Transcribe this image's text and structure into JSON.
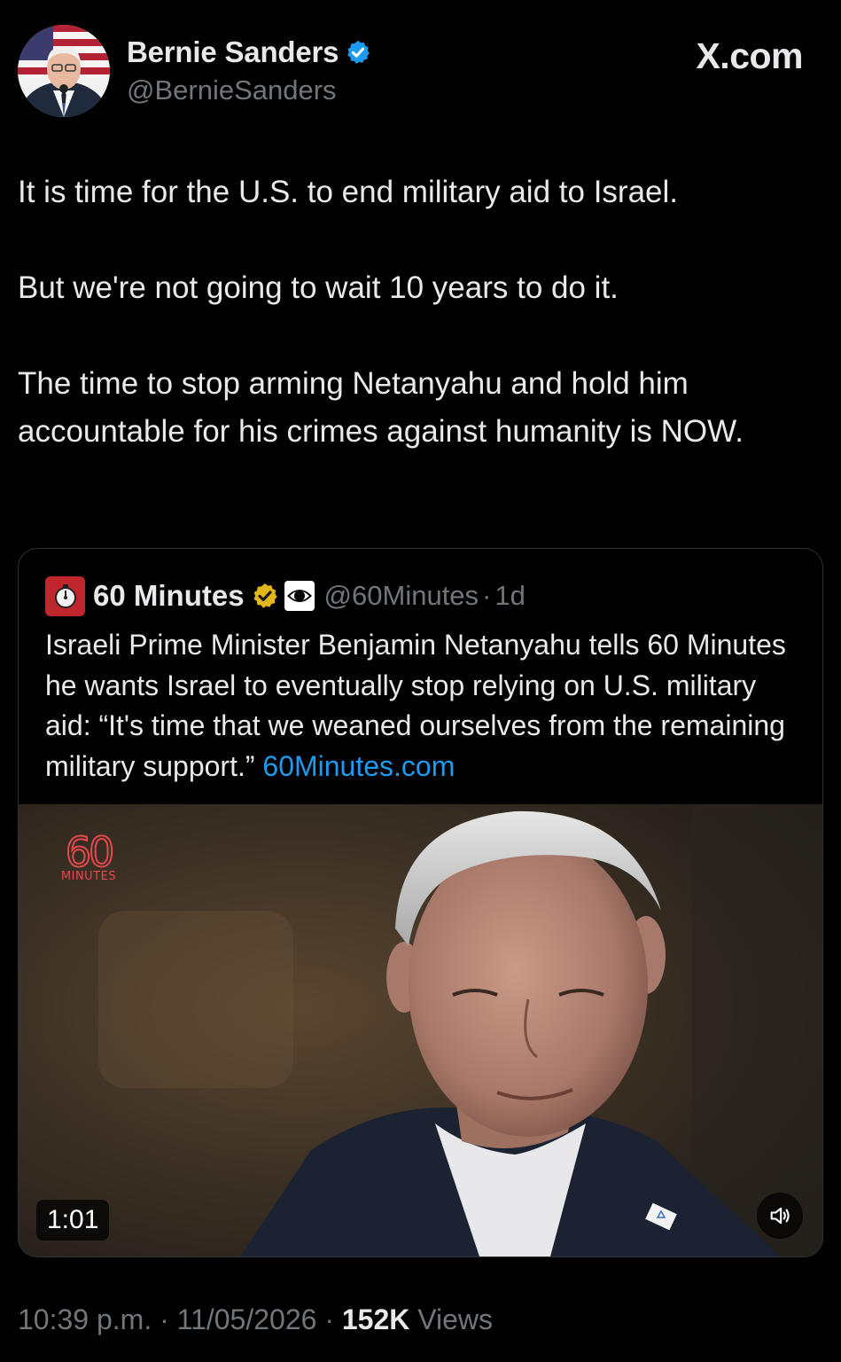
{
  "author": {
    "display_name": "Bernie Sanders",
    "handle": "@BernieSanders",
    "verified": true,
    "verified_badge_color": "#1d9bf0"
  },
  "site_label": "X.com",
  "tweet": {
    "paragraphs": [
      "It is time for the U.S. to end military aid to Israel.",
      "But we're not going to wait 10 years to do it.",
      "The time to stop arming Netanyahu and hold him accountable for his crimes against humanity is NOW."
    ]
  },
  "quote": {
    "display_name": "60 Minutes",
    "verified_badge_color": "#e2b719",
    "affiliate_icon": "cbs-eye-icon",
    "handle": "@60Minutes",
    "separator": "·",
    "time": "1d",
    "text": "Israeli Prime Minister Benjamin Netanyahu tells 60 Minutes he wants Israel to eventually stop relying on U.S. military aid: “It's time that we weaned ourselves from the remaining military support.”",
    "link_text": "60Minutes.com",
    "link_color": "#1d9bf0",
    "media": {
      "brand_number": "60",
      "brand_word": "MINUTES",
      "duration": "1:01",
      "volume_icon": "speaker-icon"
    }
  },
  "meta": {
    "time": "10:39 p.m.",
    "separator": "·",
    "date": "11/05/2026",
    "views_count": "152K",
    "views_label": "Views"
  }
}
